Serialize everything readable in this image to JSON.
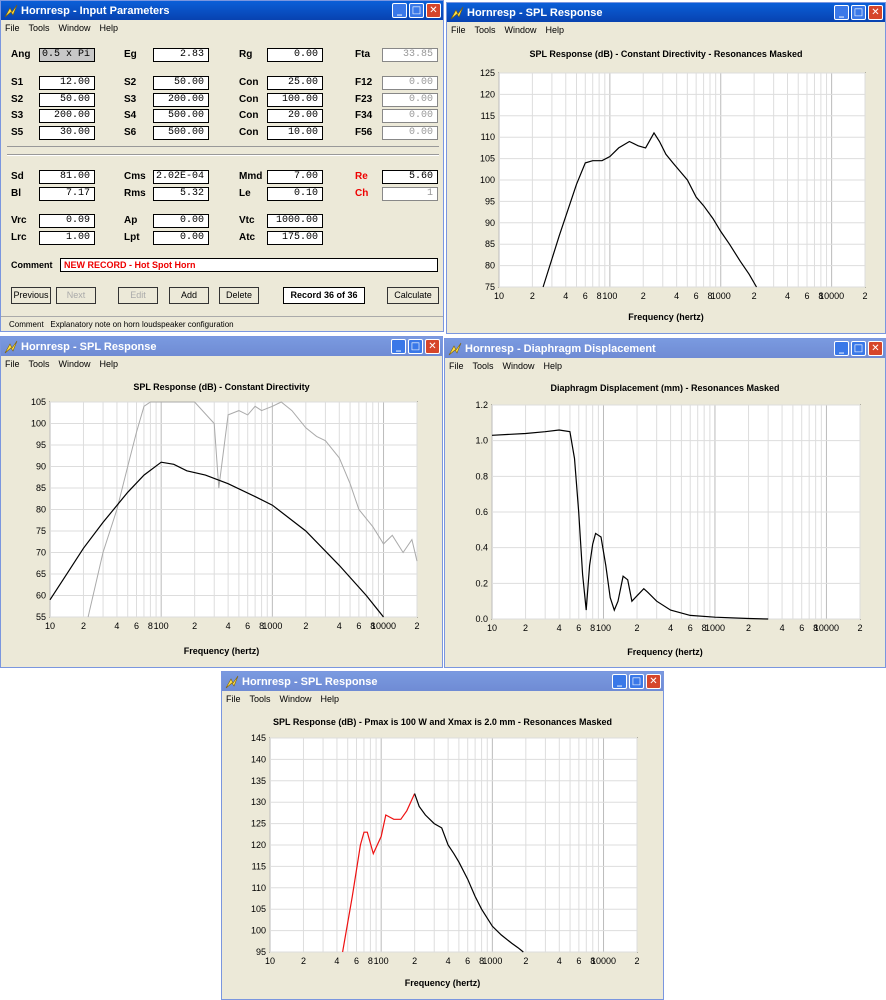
{
  "input_window": {
    "title": "Hornresp - Input Parameters",
    "menu": [
      "File",
      "Tools",
      "Window",
      "Help"
    ],
    "rows1": [
      [
        {
          "l": "Ang",
          "v": "0.5 x Pi",
          "hl": true
        },
        {
          "l": "Eg",
          "v": "2.83"
        },
        {
          "l": "Rg",
          "v": "0.00"
        },
        {
          "l": "Fta",
          "v": "33.85",
          "g": true
        }
      ]
    ],
    "rows2": [
      [
        {
          "l": "S1",
          "v": "12.00"
        },
        {
          "l": "S2",
          "v": "50.00"
        },
        {
          "l": "Con",
          "v": "25.00"
        },
        {
          "l": "F12",
          "v": "0.00",
          "g": true
        }
      ],
      [
        {
          "l": "S2",
          "v": "50.00"
        },
        {
          "l": "S3",
          "v": "200.00"
        },
        {
          "l": "Con",
          "v": "100.00"
        },
        {
          "l": "F23",
          "v": "0.00",
          "g": true
        }
      ],
      [
        {
          "l": "S3",
          "v": "200.00"
        },
        {
          "l": "S4",
          "v": "500.00"
        },
        {
          "l": "Con",
          "v": "20.00"
        },
        {
          "l": "F34",
          "v": "0.00",
          "g": true
        }
      ],
      [
        {
          "l": "S5",
          "v": "30.00"
        },
        {
          "l": "S6",
          "v": "500.00"
        },
        {
          "l": "Con",
          "v": "10.00"
        },
        {
          "l": "F56",
          "v": "0.00",
          "g": true
        }
      ]
    ],
    "rows3": [
      [
        {
          "l": "Sd",
          "v": "81.00"
        },
        {
          "l": "Cms",
          "v": "2.02E-04"
        },
        {
          "l": "Mmd",
          "v": "7.00"
        },
        {
          "l": "Re",
          "v": "5.60",
          "red": true
        }
      ],
      [
        {
          "l": "Bl",
          "v": "7.17"
        },
        {
          "l": "Rms",
          "v": "5.32"
        },
        {
          "l": "Le",
          "v": "0.10"
        },
        {
          "l": "Ch",
          "v": "1",
          "red": true,
          "g": true
        }
      ]
    ],
    "rows4": [
      [
        {
          "l": "Vrc",
          "v": "0.09"
        },
        {
          "l": "Ap",
          "v": "0.00"
        },
        {
          "l": "Vtc",
          "v": "1000.00"
        }
      ],
      [
        {
          "l": "Lrc",
          "v": "1.00"
        },
        {
          "l": "Lpt",
          "v": "0.00"
        },
        {
          "l": "Atc",
          "v": "175.00"
        }
      ]
    ],
    "comment_label": "Comment",
    "comment_value": "NEW RECORD - Hot Spot Horn",
    "buttons": {
      "previous": "Previous",
      "next": "Next",
      "edit": "Edit",
      "add": "Add",
      "delete": "Delete",
      "record": "Record 36 of 36",
      "calculate": "Calculate"
    },
    "status_label": "Comment",
    "status_text": "Explanatory note on horn loudspeaker configuration"
  },
  "spl1": {
    "title": "Hornresp - SPL Response",
    "menu": [
      "File",
      "Tools",
      "Window",
      "Help"
    ],
    "plot_title": "SPL Response (dB) - Constant Directivity - Resonances Masked",
    "xlabel": "Frequency (hertz)"
  },
  "spl2": {
    "title": "Hornresp - SPL Response",
    "menu": [
      "File",
      "Tools",
      "Window",
      "Help"
    ],
    "plot_title": "SPL Response (dB) - Constant Directivity",
    "xlabel": "Frequency (hertz)"
  },
  "disp": {
    "title": "Hornresp - Diaphragm Displacement",
    "menu": [
      "File",
      "Tools",
      "Window",
      "Help"
    ],
    "plot_title": "Diaphragm Displacement (mm) - Resonances Masked",
    "xlabel": "Frequency (hertz)"
  },
  "spl3": {
    "title": "Hornresp - SPL Response",
    "menu": [
      "File",
      "Tools",
      "Window",
      "Help"
    ],
    "plot_title": "SPL Response (dB) - Pmax is 100 W and Xmax is 2.0 mm - Resonances Masked",
    "xlabel": "Frequency (hertz)"
  },
  "xticks": [
    "10",
    "2",
    "4",
    "6",
    "8",
    "100",
    "2",
    "4",
    "6",
    "8",
    "1000",
    "2",
    "4",
    "6",
    "8",
    "10000",
    "2"
  ],
  "colors": {
    "titlebar": "#0a5fd8",
    "red_curve": "#ee1111",
    "gray_curve": "#aaaaaa"
  },
  "chart_data": [
    {
      "type": "line",
      "ylim": [
        75,
        125
      ],
      "xlim": [
        10,
        20000
      ],
      "log_x": true,
      "yticks": [
        75,
        80,
        85,
        90,
        95,
        100,
        105,
        110,
        115,
        120,
        125
      ],
      "series": [
        {
          "color": "#000",
          "x": [
            25,
            35,
            50,
            60,
            70,
            85,
            100,
            120,
            150,
            180,
            210,
            250,
            280,
            320,
            370,
            430,
            500,
            600,
            700,
            850,
            1000,
            1200,
            1500,
            1800,
            2100
          ],
          "values": [
            75,
            87,
            99,
            104,
            104.5,
            104.5,
            105.5,
            107.5,
            109,
            108,
            107.5,
            111,
            109,
            106,
            104,
            102,
            100,
            96,
            94,
            91,
            88,
            85,
            81,
            78,
            75
          ]
        }
      ]
    },
    {
      "type": "line",
      "ylim": [
        55,
        105
      ],
      "xlim": [
        10,
        20000
      ],
      "log_x": true,
      "yticks": [
        55,
        60,
        65,
        70,
        75,
        80,
        85,
        90,
        95,
        100,
        105
      ],
      "series": [
        {
          "color": "#000",
          "x": [
            10,
            15,
            20,
            30,
            50,
            70,
            100,
            130,
            170,
            250,
            400,
            700,
            1000,
            2000,
            4000,
            7000,
            10000
          ],
          "values": [
            59,
            66,
            71,
            77,
            84,
            88,
            91,
            90.5,
            89,
            88,
            86,
            83,
            81,
            75,
            67,
            60,
            55
          ]
        },
        {
          "color": "#aaa",
          "x": [
            22,
            30,
            40,
            50,
            60,
            70,
            80,
            90,
            100,
            200,
            300,
            330,
            400,
            500,
            600,
            700,
            800,
            1000,
            1200,
            1500,
            2000,
            2500,
            3000,
            4000,
            5000,
            6000,
            8000,
            10000,
            12000,
            15000,
            18000,
            20000
          ],
          "values": [
            55,
            70,
            80,
            90,
            98,
            104,
            105,
            105,
            105,
            105,
            100,
            85,
            102,
            103,
            102,
            104,
            103,
            104,
            105,
            103,
            99,
            97,
            96,
            92,
            86,
            80,
            76,
            72,
            74,
            70,
            73,
            68
          ]
        }
      ]
    },
    {
      "type": "line",
      "ylim": [
        0,
        1.2
      ],
      "xlim": [
        10,
        20000
      ],
      "log_x": true,
      "yticks": [
        0,
        0.2,
        0.4,
        0.6,
        0.8,
        1,
        1.2
      ],
      "series": [
        {
          "color": "#000",
          "x": [
            10,
            20,
            30,
            40,
            50,
            55,
            60,
            65,
            70,
            75,
            80,
            85,
            95,
            105,
            115,
            125,
            135,
            150,
            165,
            180,
            200,
            230,
            250,
            300,
            400,
            600,
            1000,
            2000,
            3000
          ],
          "values": [
            1.03,
            1.04,
            1.05,
            1.06,
            1.05,
            0.9,
            0.6,
            0.25,
            0.05,
            0.3,
            0.42,
            0.48,
            0.46,
            0.3,
            0.12,
            0.05,
            0.1,
            0.24,
            0.22,
            0.1,
            0.13,
            0.17,
            0.15,
            0.1,
            0.05,
            0.02,
            0.01,
            0.003,
            0
          ]
        }
      ]
    },
    {
      "type": "line",
      "ylim": [
        95,
        145
      ],
      "xlim": [
        10,
        20000
      ],
      "log_x": true,
      "yticks": [
        95,
        100,
        105,
        110,
        115,
        120,
        125,
        130,
        135,
        140,
        145
      ],
      "series": [
        {
          "color": "#e11",
          "x": [
            45,
            55,
            65,
            70,
            75,
            85,
            100,
            110,
            130,
            150,
            170,
            200
          ],
          "values": [
            95,
            108,
            120,
            123,
            123,
            118,
            122,
            127,
            126,
            126,
            128,
            132
          ]
        },
        {
          "color": "#000",
          "x": [
            200,
            220,
            250,
            300,
            350,
            400,
            450,
            500,
            600,
            700,
            800,
            1000,
            1200,
            1500,
            1700,
            1900
          ],
          "values": [
            132,
            129,
            127,
            125,
            124,
            120,
            118,
            116,
            112,
            108,
            105,
            101,
            99,
            97,
            96,
            95
          ]
        }
      ]
    }
  ]
}
